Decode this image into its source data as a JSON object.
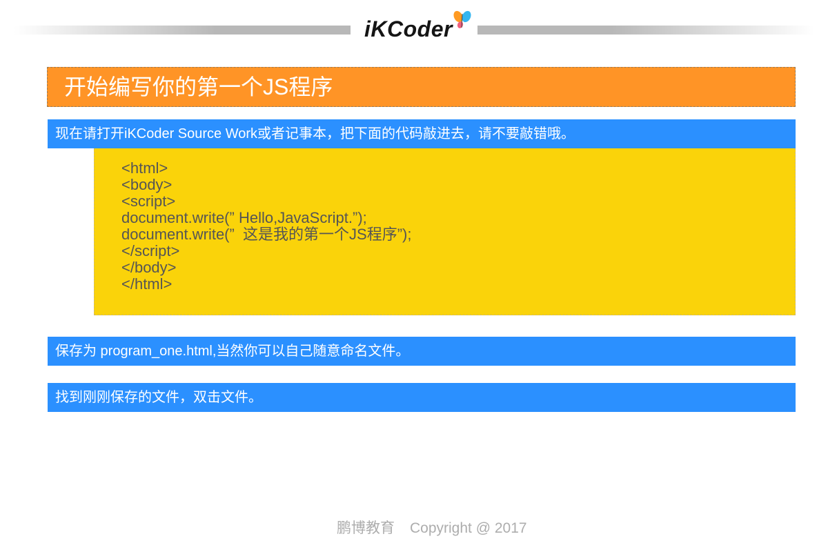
{
  "header": {
    "logo_text": "iKCoder",
    "logo_icon": "butterfly-icon"
  },
  "slide": {
    "title": "开始编写你的第一个JS程序",
    "steps": [
      "现在请打开iKCoder Source Work或者记事本，把下面的代码敲进去，请不要敲错哦。",
      "保存为 program_one.html,当然你可以自己随意命名文件。",
      "找到刚刚保存的文件，双击文件。"
    ],
    "code_lines": [
      "<html>",
      "<body>",
      "<script>",
      "document.write(” Hello,JavaScript.”);",
      "document.write(”  这是我的第一个JS程序”);",
      "</script>",
      "</body>",
      "</html>"
    ]
  },
  "footer": {
    "organization": "鹏博教育",
    "copyright": "Copyright @ 2017"
  },
  "colors": {
    "title_bg": "#FF9426",
    "step_bg": "#2B90FF",
    "code_bg": "#FAD30A",
    "code_text": "#555555",
    "footer_text": "#ADADAD",
    "header_bar": "#B8B8B8"
  }
}
